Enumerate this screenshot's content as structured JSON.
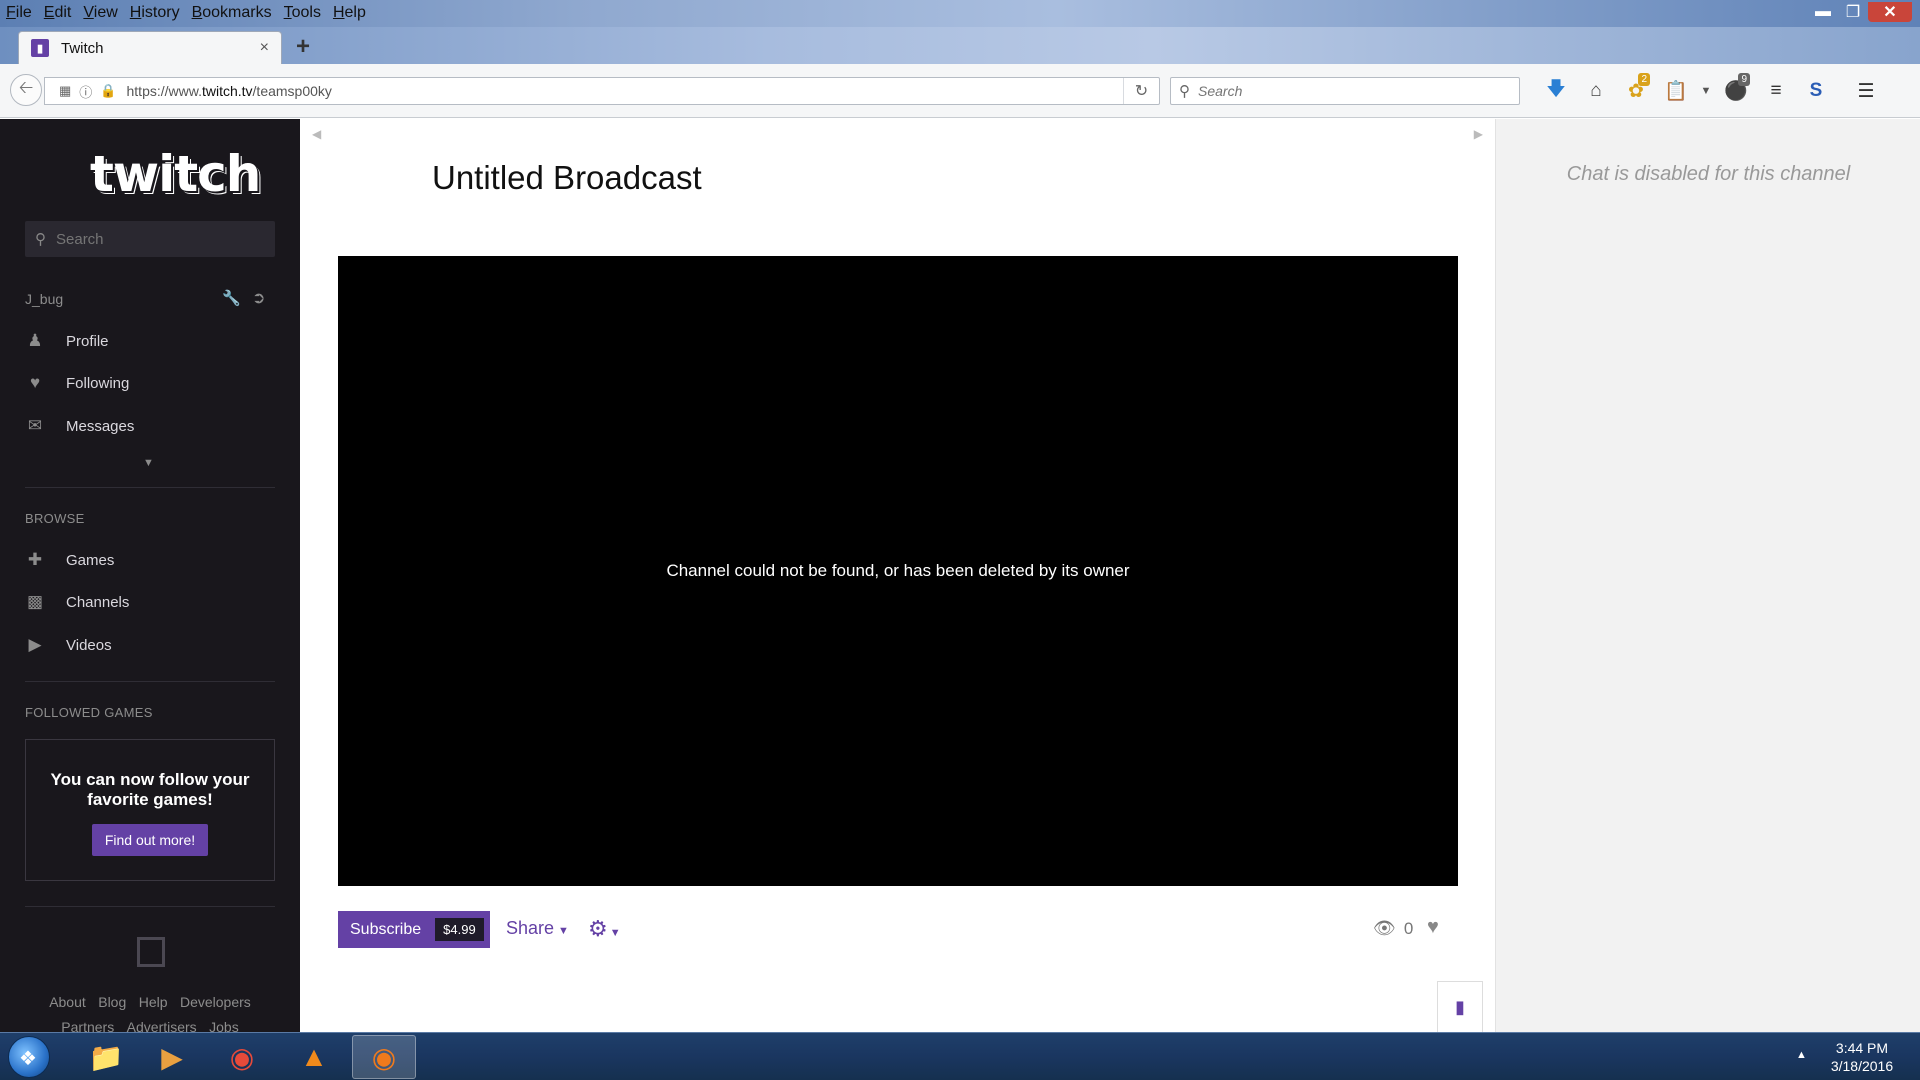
{
  "browser": {
    "menus": [
      "File",
      "Edit",
      "View",
      "History",
      "Bookmarks",
      "Tools",
      "Help"
    ],
    "tab": {
      "title": "Twitch",
      "close": "×"
    },
    "new_tab": "+",
    "url_prefix": "https://www.",
    "url_host": "twitch.tv",
    "url_path": "/teamsp00ky",
    "search_placeholder": "Search",
    "badges": {
      "notifications": "2",
      "ublock": "9"
    }
  },
  "sidebar": {
    "logo": "twitch",
    "search_placeholder": "Search",
    "username": "J_bug",
    "user_links": [
      "Profile",
      "Following",
      "Messages"
    ],
    "browse_heading": "BROWSE",
    "browse_links": [
      "Games",
      "Channels",
      "Videos"
    ],
    "followed_games_heading": "FOLLOWED GAMES",
    "follow_promo": "You can now follow your favorite games!",
    "find_out_more": "Find out more!",
    "footer_links_row1": [
      "About",
      "Blog",
      "Help",
      "Developers"
    ],
    "footer_links_row2": [
      "Partners",
      "Advertisers",
      "Jobs"
    ]
  },
  "main": {
    "title": "Untitled Broadcast",
    "player_message": "Channel could not be found, or has been deleted by its owner",
    "subscribe_label": "Subscribe",
    "subscribe_price": "$4.99",
    "share_label": "Share",
    "viewer_count": "0"
  },
  "chat": {
    "disabled_message": "Chat is disabled for this channel"
  },
  "taskbar": {
    "time": "3:44 PM",
    "date": "3/18/2016"
  },
  "colors": {
    "twitch_purple": "#6441a5",
    "sidebar_bg": "#19171c"
  }
}
